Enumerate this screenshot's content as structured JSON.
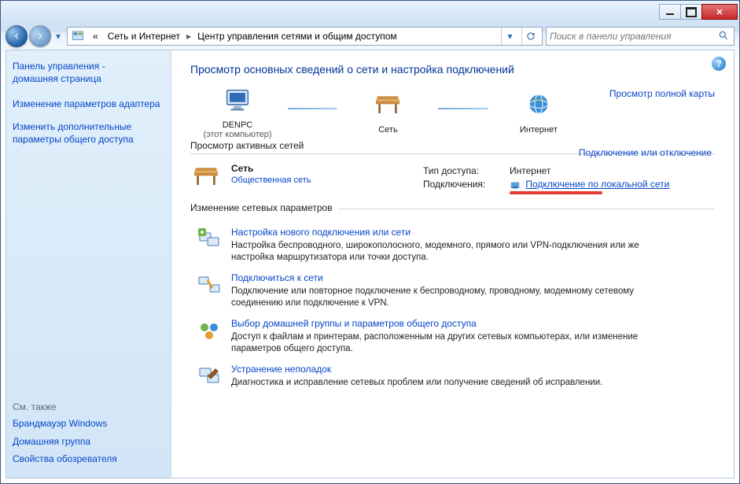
{
  "titlebar": {},
  "nav": {
    "path_prefix_indicator": "«",
    "crumb1": "Сеть и Интернет",
    "crumb2": "Центр управления сетями и общим доступом"
  },
  "search": {
    "placeholder": "Поиск в панели управления"
  },
  "sidebar": {
    "home_line1": "Панель управления -",
    "home_line2": "домашняя страница",
    "link_adapter": "Изменение параметров адаптера",
    "link_sharing": "Изменить дополнительные параметры общего доступа",
    "seealso_header": "См. также",
    "seealso_firewall": "Брандмауэр Windows",
    "seealso_homegroup": "Домашняя группа",
    "seealso_inetopts": "Свойства обозревателя"
  },
  "main": {
    "title": "Просмотр основных сведений о сети и настройка подключений",
    "map": {
      "node1_label": "DENPC",
      "node1_sub": "(этот компьютер)",
      "node2_label": "Сеть",
      "node3_label": "Интернет",
      "full_map_link": "Просмотр полной карты"
    },
    "active_header": "Просмотр активных сетей",
    "active_action": "Подключение или отключение",
    "network": {
      "name": "Сеть",
      "type": "Общественная сеть",
      "access_label": "Тип доступа:",
      "access_value": "Интернет",
      "conn_label": "Подключения:",
      "conn_link": "Подключение по локальной сети"
    },
    "change_header": "Изменение сетевых параметров",
    "tasks": [
      {
        "title": "Настройка нового подключения или сети",
        "desc": "Настройка беспроводного, широкополосного, модемного, прямого или VPN-подключения или же настройка маршрутизатора или точки доступа."
      },
      {
        "title": "Подключиться к сети",
        "desc": "Подключение или повторное подключение к беспроводному, проводному, модемному сетевому соединению или подключение к VPN."
      },
      {
        "title": "Выбор домашней группы и параметров общего доступа",
        "desc": "Доступ к файлам и принтерам, расположенным на других сетевых компьютерах, или изменение параметров общего доступа."
      },
      {
        "title": "Устранение неполадок",
        "desc": "Диагностика и исправление сетевых проблем или получение сведений об исправлении."
      }
    ]
  }
}
